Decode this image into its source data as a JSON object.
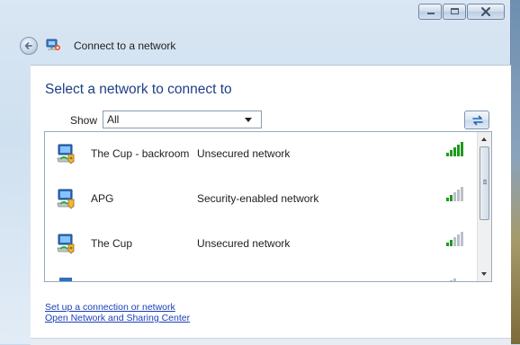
{
  "window": {
    "title": "Connect to a network"
  },
  "main": {
    "heading": "Select a network to connect to",
    "show_label": "Show",
    "show_value": "All"
  },
  "networks": [
    {
      "name": "The Cup - backroom",
      "security": "Unsecured network",
      "signal_bars": 5,
      "locked": false
    },
    {
      "name": "APG",
      "security": "Security-enabled network",
      "signal_bars": 2,
      "locked": true
    },
    {
      "name": "The Cup",
      "security": "Unsecured network",
      "signal_bars": 2,
      "locked": false
    }
  ],
  "links": {
    "setup": "Set up a connection or network",
    "sharing": "Open Network and Sharing Center"
  },
  "colors": {
    "heading": "#1d3f86",
    "link": "#1a3fb8",
    "signal_on": "#1e9a1e",
    "signal_off": "#b9c0c8"
  },
  "icons": {
    "back": "back-arrow-icon",
    "wizard": "network-wizard-icon",
    "refresh": "refresh-icon",
    "network": "wireless-network-icon",
    "signal": "signal-strength-icon"
  }
}
